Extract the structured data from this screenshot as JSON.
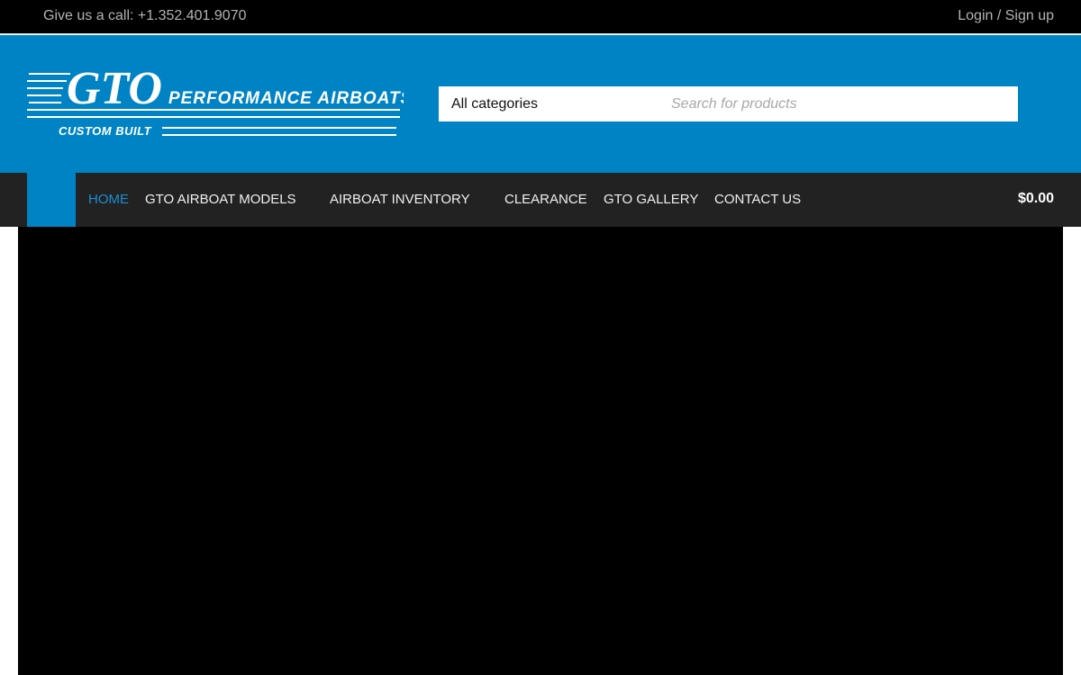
{
  "topbar": {
    "phone_text": "Give us a call: +1.352.401.9070",
    "auth_text": "Login / Sign up"
  },
  "logo": {
    "brand": "GTO",
    "tagline": "PERFORMANCE AIRBOATS",
    "subline": "CUSTOM BUILT"
  },
  "search": {
    "category_label": "All categories",
    "placeholder": "Search for products",
    "value": ""
  },
  "nav": {
    "items": [
      {
        "label": "HOME",
        "active": true
      },
      {
        "label": "GTO AIRBOAT MODELS"
      },
      {
        "label": "AIRBOAT INVENTORY"
      },
      {
        "label": "CLEARANCE"
      },
      {
        "label": "GTO GALLERY"
      },
      {
        "label": "CONTACT US"
      }
    ],
    "cart_total": "$0.00"
  },
  "colors": {
    "brand_blue": "#0083c4",
    "nav_bg": "#222222",
    "active_link": "#1b8ed0"
  }
}
